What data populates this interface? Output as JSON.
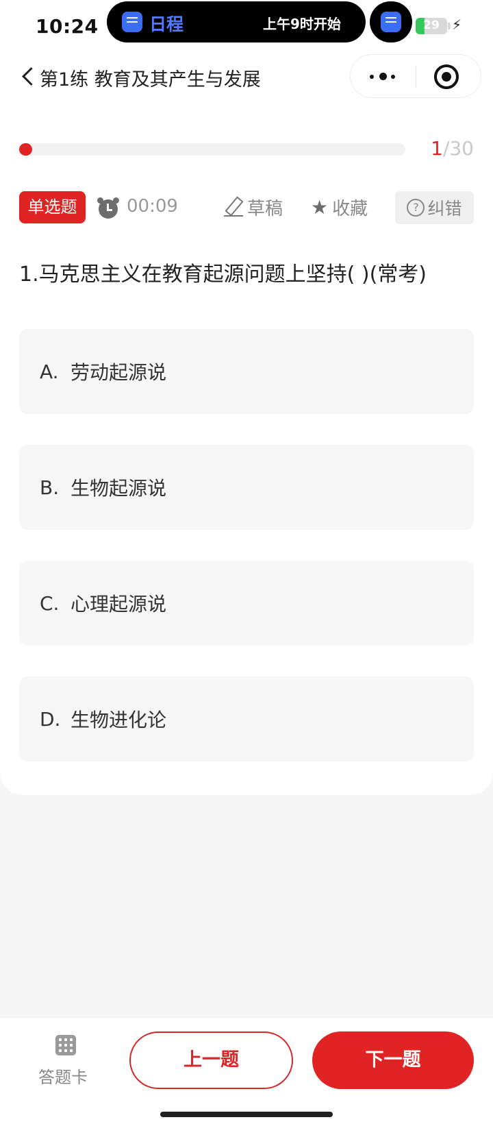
{
  "status_bar": {
    "time": "10:24",
    "island_title": "日程",
    "island_detail": "上午9时开始",
    "battery_level": "29"
  },
  "header": {
    "title": "第1练 教育及其产生与发展"
  },
  "progress": {
    "current": "1",
    "total_text": "/30",
    "fraction": 0.0333
  },
  "toolbar": {
    "type_label": "单选题",
    "timer": "00:09",
    "draft_label": "草稿",
    "favorite_label": "收藏",
    "report_label": "纠错"
  },
  "question": {
    "text": "1.马克思主义在教育起源问题上坚持( )(常考)",
    "options": [
      {
        "letter": "A.",
        "text": "劳动起源说"
      },
      {
        "letter": "B.",
        "text": "生物起源说"
      },
      {
        "letter": "C.",
        "text": "心理起源说"
      },
      {
        "letter": "D.",
        "text": "生物进化论"
      }
    ]
  },
  "bottom_bar": {
    "answer_card_label": "答题卡",
    "prev_label": "上一题",
    "next_label": "下一题"
  },
  "colors": {
    "accent": "#e02424",
    "option_bg": "#f6f6f6",
    "island_accent": "#4f7cff",
    "battery_green": "#35c759"
  },
  "icons": [
    "back-icon",
    "more-icon",
    "close-target-icon",
    "alarm-icon",
    "pencil-icon",
    "star-icon",
    "help-icon",
    "grid-icon",
    "charge-icon"
  ]
}
